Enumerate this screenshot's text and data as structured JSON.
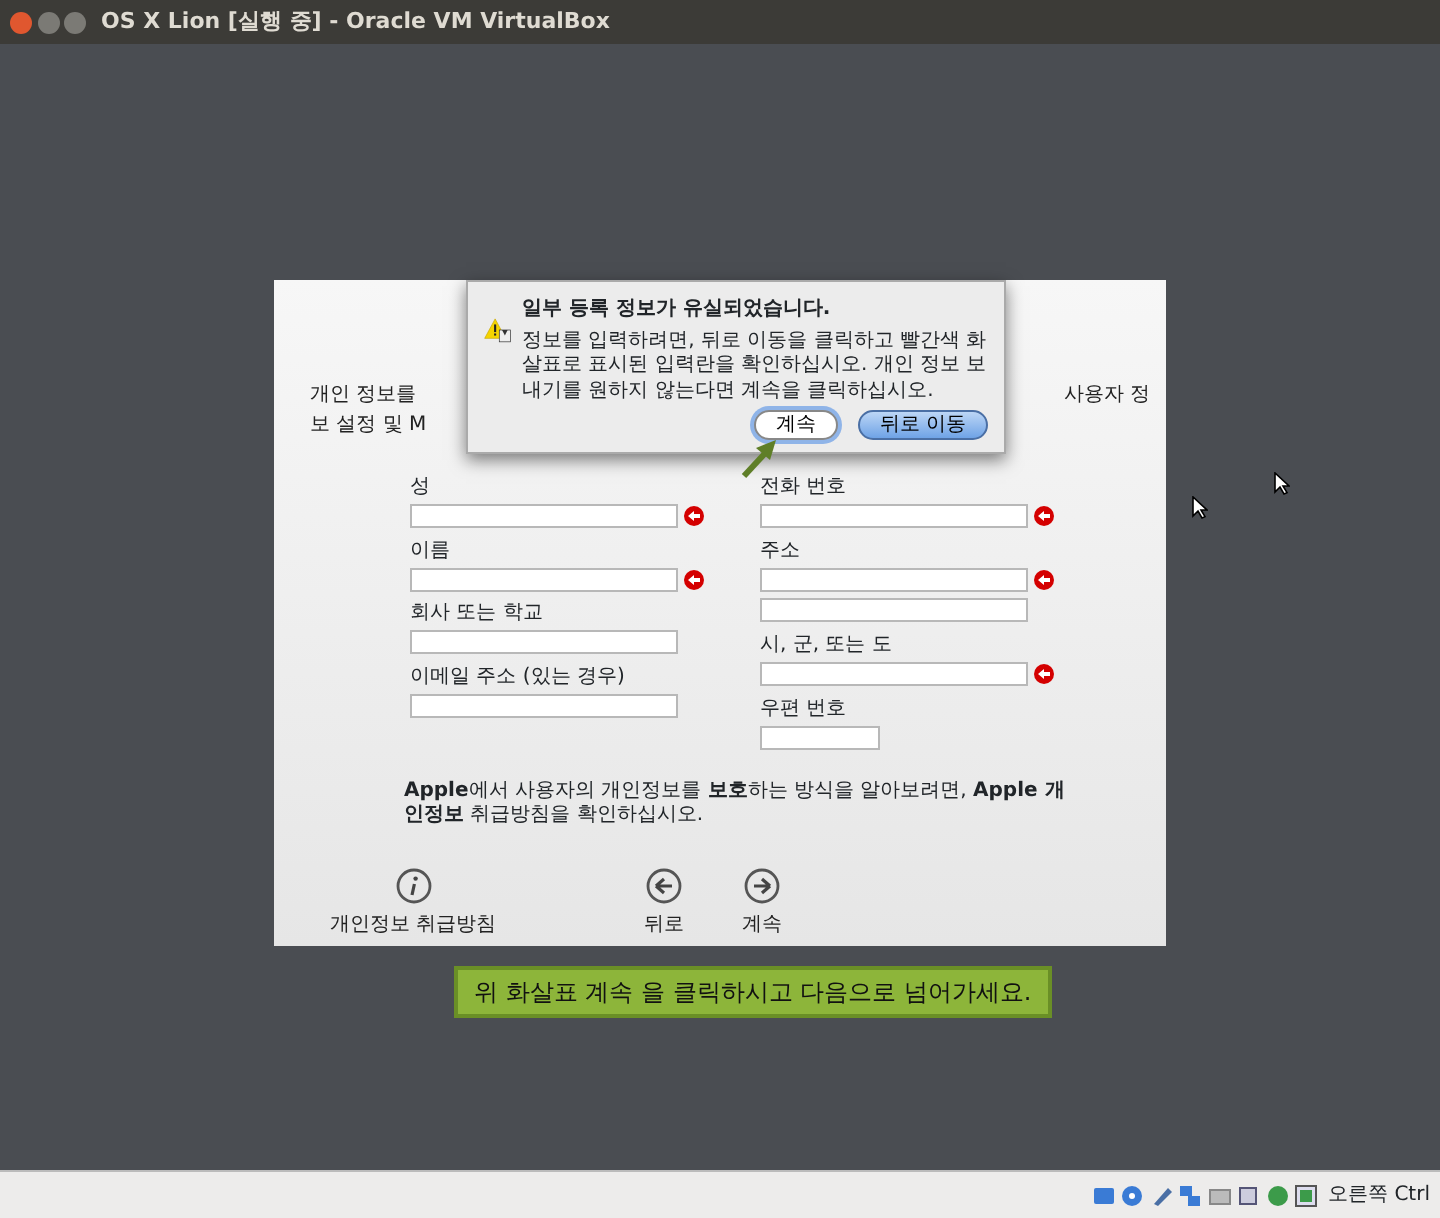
{
  "window": {
    "title": "OS X Lion [실행 중] - Oracle VM VirtualBox"
  },
  "intro": {
    "left": "개인 정보를",
    "right": "사용자 정",
    "line2": "보 설정 및 M"
  },
  "dialog": {
    "title": "일부 등록 정보가 유실되었습니다.",
    "message": "정보를 입력하려면, 뒤로 이동을 클릭하고 빨간색 화살표로 표시된 입력란을 확인하십시오. 개인 정보 보내기를 원하지 않는다면 계속을 클릭하십시오.",
    "buttons": [
      {
        "label": "계속",
        "kind": "plain"
      },
      {
        "label": "뒤로 이동",
        "kind": "default"
      }
    ]
  },
  "fields_left": [
    {
      "label": "성",
      "kind": "text",
      "required": true
    },
    {
      "label": "이름",
      "kind": "text",
      "required": true
    },
    {
      "label": "회사 또는 학교",
      "kind": "text",
      "required": false
    },
    {
      "label": "이메일 주소 (있는 경우)",
      "kind": "text",
      "required": false
    }
  ],
  "fields_right": [
    {
      "label": "전화 번호",
      "kind": "text",
      "required": true
    },
    {
      "label": "주소",
      "kind": "double",
      "required": true
    },
    {
      "label": "시, 군, 또는 도",
      "kind": "text",
      "required": true
    },
    {
      "label": "우편 번호",
      "kind": "short",
      "required": false
    }
  ],
  "privacy_note": "**Apple**에서 사용자의 개인정보를 **보호**하는 방식을 알아보려면, **Apple 개인정보** 취급방침을 확인하십시오.",
  "nav": [
    {
      "label": "개인정보 취급방침",
      "kind": "info"
    },
    {
      "label": "뒤로",
      "kind": "back"
    },
    {
      "label": "계속",
      "kind": "next"
    }
  ],
  "caption": "위 화살표 계속 을 클릭하시고 다음으로 넘어가세요.",
  "status_bar": {
    "host_key": "오른쪽 Ctrl"
  }
}
